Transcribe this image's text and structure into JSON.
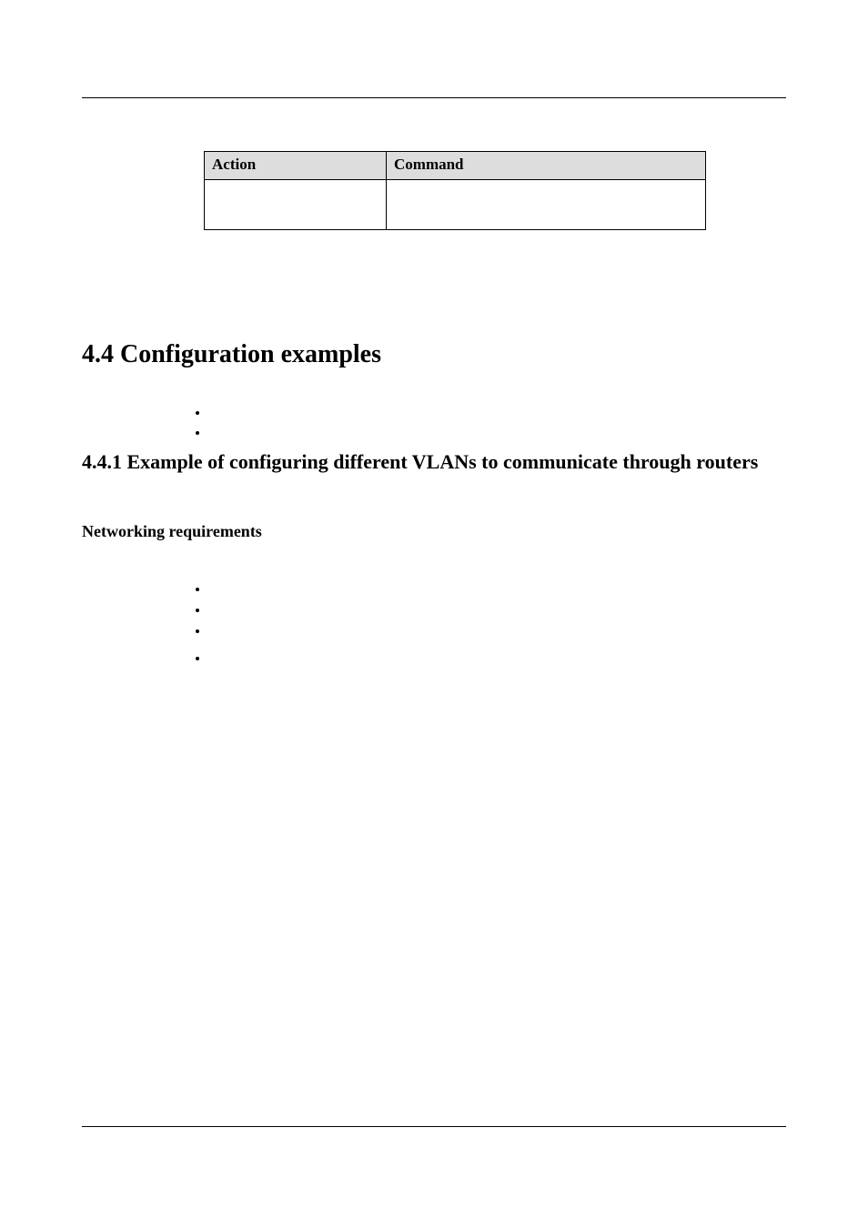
{
  "table": {
    "headers": {
      "action": "Action",
      "command": "Command"
    },
    "cells": {
      "action": "",
      "command": ""
    }
  },
  "h1": "4.4 Configuration examples",
  "h2": "4.4.1 Example of configuring different VLANs to communicate through routers",
  "h3": "Networking requirements",
  "bullets_a": [
    "",
    ""
  ],
  "bullets_b": [
    "",
    "",
    "",
    ""
  ]
}
